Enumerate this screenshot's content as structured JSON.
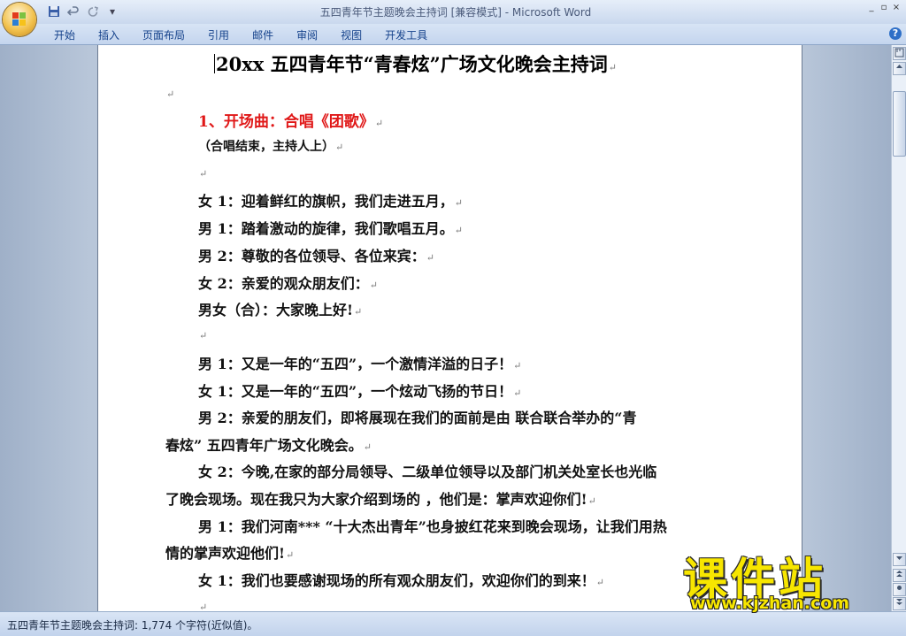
{
  "window": {
    "title": "五四青年节主题晚会主持词 [兼容模式] - Microsoft Word",
    "controls": [
      "_",
      "▫",
      "×"
    ]
  },
  "qat": {
    "save_icon": "save-icon",
    "undo_icon": "undo-icon",
    "redo_icon": "redo-icon",
    "dropdown_glyph": "▾"
  },
  "ribbon_tabs": [
    "开始",
    "插入",
    "页面布局",
    "引用",
    "邮件",
    "审阅",
    "视图",
    "开发工具"
  ],
  "help": "?",
  "document": {
    "title": "20xx 五四青年节“青春炫”广场文化晚会主持词",
    "para_mark": "↵",
    "lines": [
      "",
      "1、开场曲：合唱《团歌》",
      "（合唱结束，主持人上）",
      "",
      "女 1：迎着鲜红的旗帜，我们走进五月，",
      "男 1：踏着激动的旋律，我们歌唱五月。",
      "男 2：尊敬的各位领导、各位来宾：",
      "女 2：亲爱的观众朋友们：",
      "男女（合）：大家晚上好!",
      "",
      "男 1：又是一年的“五四”，一个激情洋溢的日子！",
      "女 1：又是一年的“五四”，一个炫动飞扬的节日！",
      "男 2：亲爱的朋友们，即将展现在我们的面前是由          联合联合举办的“青",
      "春炫” 五四青年广场文化晚会。",
      "女  2：今晚,在家的部分局领导、二级单位领导以及部门机关处室长也光临",
      "了晚会现场。现在我只为大家介绍到场的       ，他们是：掌声欢迎你们!",
      "男  1：我们河南*** “十大杰出青年”也身披红花来到晚会现场，让我们用热",
      "情的掌声欢迎他们!",
      "女 1：我们也要感谢现场的所有观众朋友们，欢迎你们的到来！",
      ""
    ]
  },
  "statusbar": {
    "text": "五四青年节主题晚会主持词: 1,774 个字符(近似值)。"
  },
  "watermark": {
    "title": "课件站",
    "url": "www.kjzhan.com"
  },
  "colors": {
    "heading_red": "#e01818",
    "watermark_yellow": "#f7e600",
    "ribbon_text": "#15428b"
  }
}
